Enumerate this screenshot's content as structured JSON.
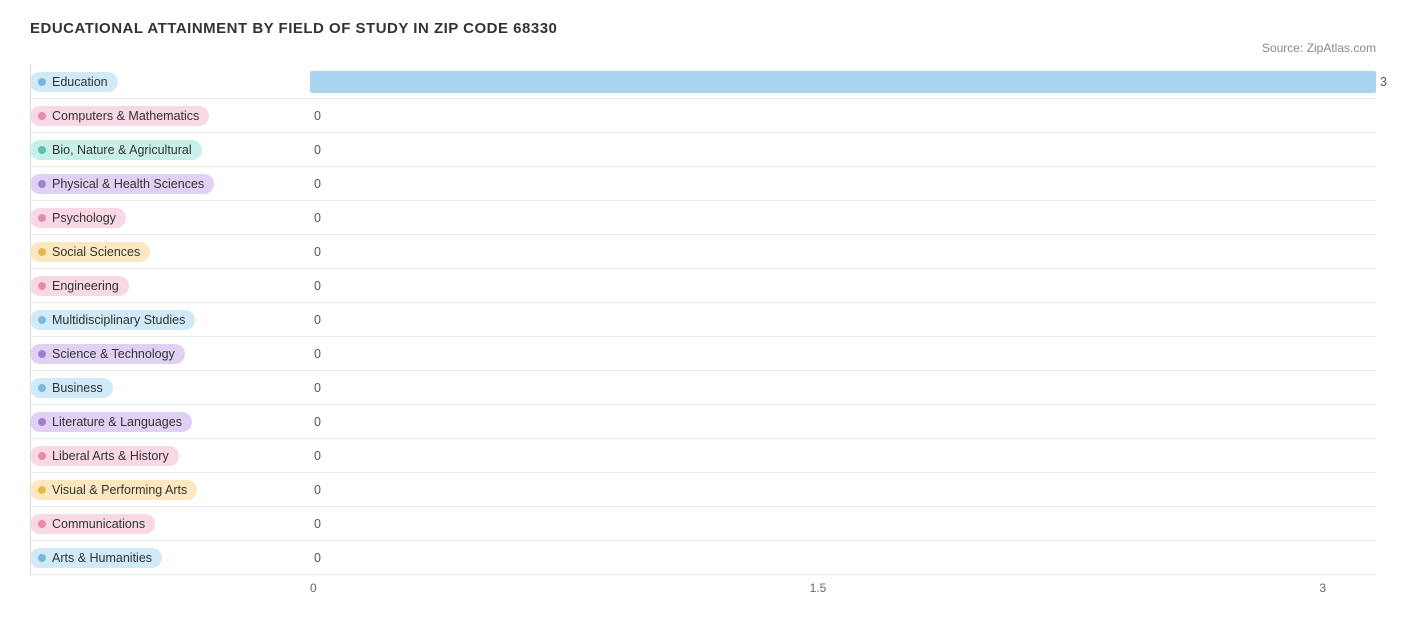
{
  "title": "EDUCATIONAL ATTAINMENT BY FIELD OF STUDY IN ZIP CODE 68330",
  "source": "Source: ZipAtlas.com",
  "xAxis": {
    "labels": [
      "0",
      "1.5",
      "3"
    ],
    "max": 3
  },
  "bars": [
    {
      "label": "Education",
      "value": 3,
      "colorClass": "color-blue",
      "dotClass": "dot-blue",
      "pillBg": "#d0eaf8"
    },
    {
      "label": "Computers & Mathematics",
      "value": 0,
      "colorClass": "color-pink",
      "dotClass": "dot-pink",
      "pillBg": "#f8d8e4"
    },
    {
      "label": "Bio, Nature & Agricultural",
      "value": 0,
      "colorClass": "color-teal",
      "dotClass": "dot-teal",
      "pillBg": "#c8f0e8"
    },
    {
      "label": "Physical & Health Sciences",
      "value": 0,
      "colorClass": "color-purple",
      "dotClass": "dot-purple",
      "pillBg": "#e0d0f4"
    },
    {
      "label": "Psychology",
      "value": 0,
      "colorClass": "color-pink",
      "dotClass": "dot-pink",
      "pillBg": "#f8d8e4"
    },
    {
      "label": "Social Sciences",
      "value": 0,
      "colorClass": "color-peach",
      "dotClass": "dot-peach",
      "pillBg": "#fce8c0"
    },
    {
      "label": "Engineering",
      "value": 0,
      "colorClass": "color-pink",
      "dotClass": "dot-pink",
      "pillBg": "#f8d8e4"
    },
    {
      "label": "Multidisciplinary Studies",
      "value": 0,
      "colorClass": "color-blue",
      "dotClass": "dot-blue",
      "pillBg": "#d0eaf8"
    },
    {
      "label": "Science & Technology",
      "value": 0,
      "colorClass": "color-purple",
      "dotClass": "dot-purple",
      "pillBg": "#e0d0f4"
    },
    {
      "label": "Business",
      "value": 0,
      "colorClass": "color-blue",
      "dotClass": "dot-blue",
      "pillBg": "#d0eaf8"
    },
    {
      "label": "Literature & Languages",
      "value": 0,
      "colorClass": "color-purple",
      "dotClass": "dot-purple",
      "pillBg": "#e0d0f4"
    },
    {
      "label": "Liberal Arts & History",
      "value": 0,
      "colorClass": "color-pink",
      "dotClass": "dot-pink",
      "pillBg": "#f8d8e4"
    },
    {
      "label": "Visual & Performing Arts",
      "value": 0,
      "colorClass": "color-peach",
      "dotClass": "dot-peach",
      "pillBg": "#fce8c0"
    },
    {
      "label": "Communications",
      "value": 0,
      "colorClass": "color-pink",
      "dotClass": "dot-pink",
      "pillBg": "#f8d8e4"
    },
    {
      "label": "Arts & Humanities",
      "value": 0,
      "colorClass": "color-blue",
      "dotClass": "dot-blue",
      "pillBg": "#d0eaf8"
    }
  ]
}
